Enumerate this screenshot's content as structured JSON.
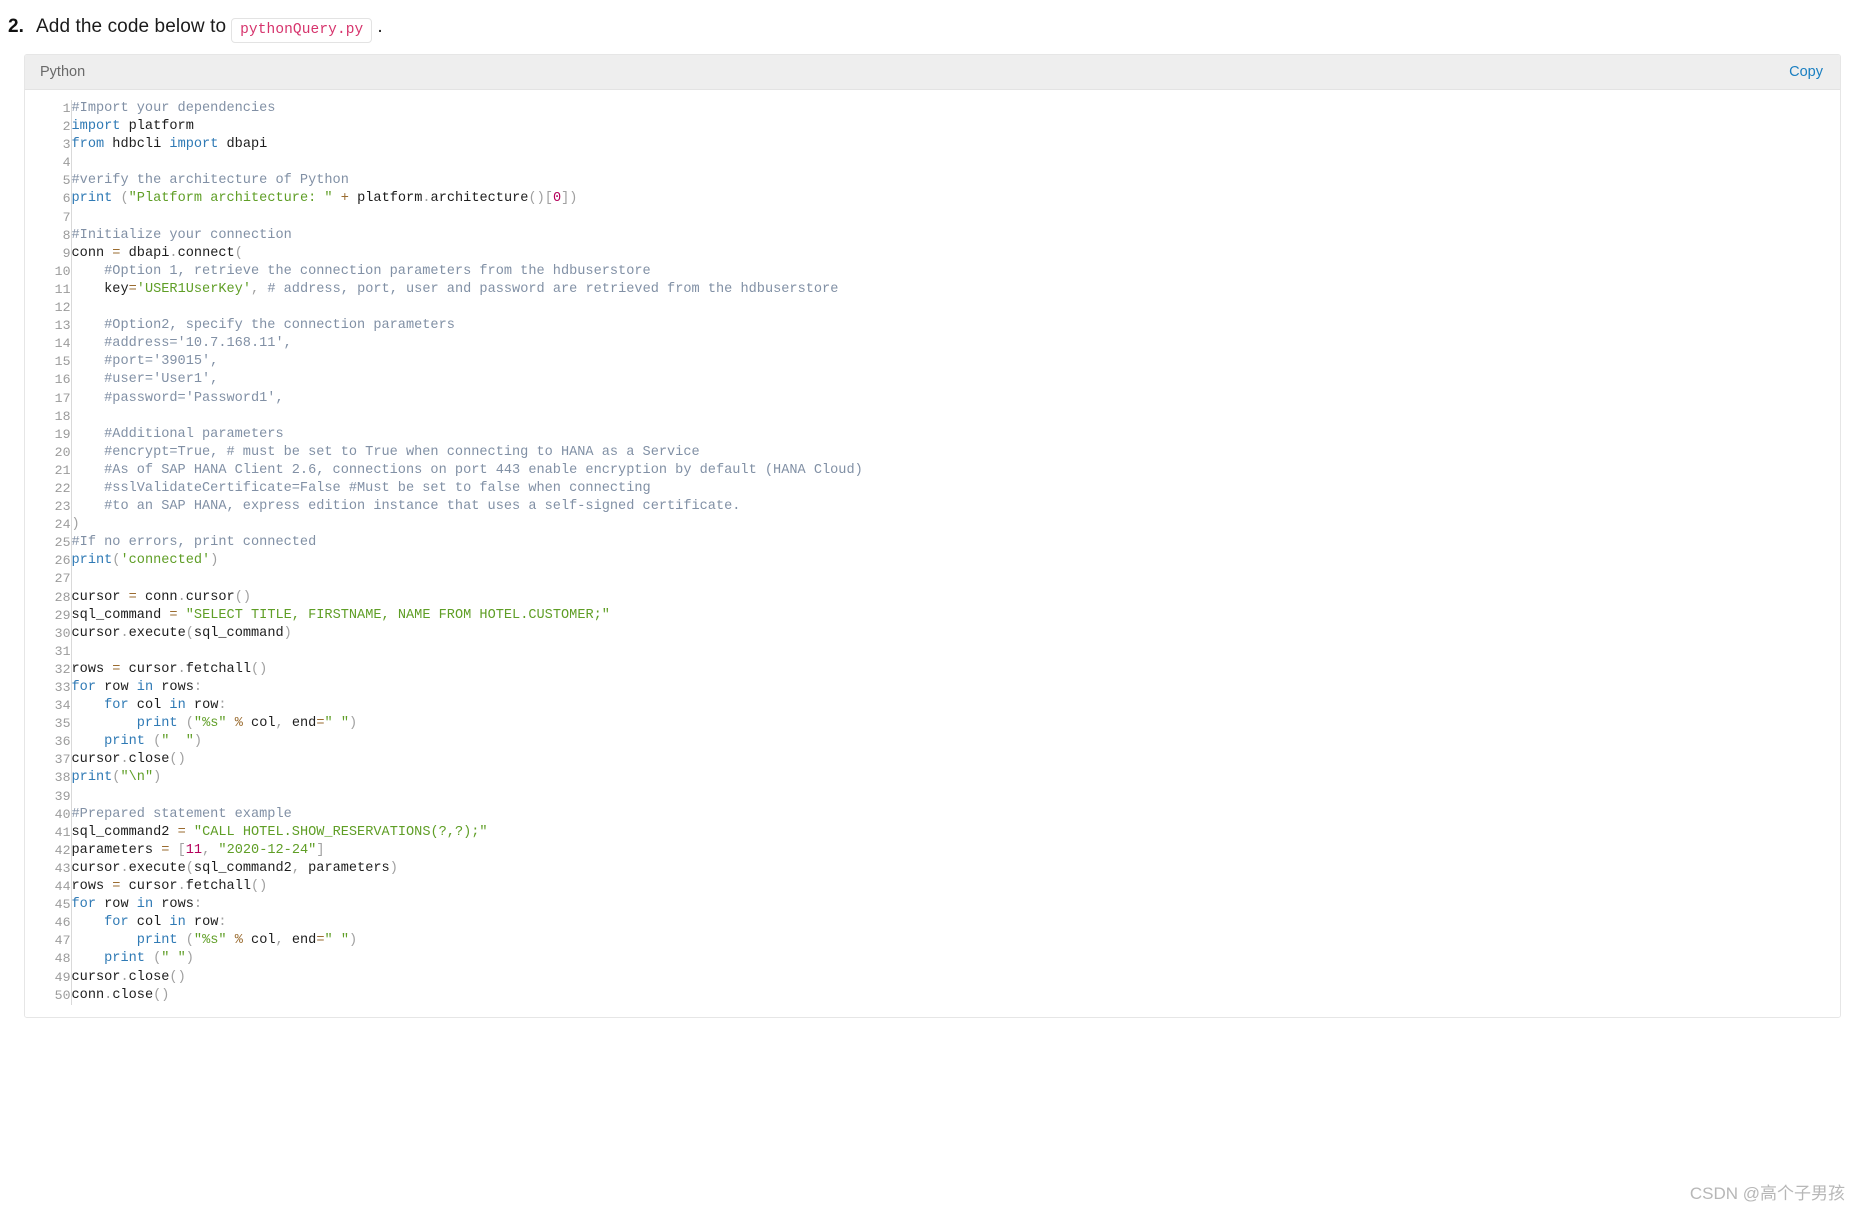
{
  "step": {
    "number": "2.",
    "text_before": "Add the code below to",
    "inline_code": "pythonQuery.py",
    "text_after": "."
  },
  "code_block": {
    "language": "Python",
    "copy_label": "Copy",
    "first_line": 1,
    "total_lines": 50,
    "colors": {
      "comment": "#8190a5",
      "keyword": "#2f7ab5",
      "string": "#5f9e26",
      "number": "#b4005a",
      "operator": "#9a6b2f",
      "punctuation": "#a0a0a0",
      "plain": "#1d1d1d",
      "header_bg": "#eeeeee",
      "link": "#1a7fc1"
    },
    "lines": [
      [
        [
          "c-com",
          "#Import your dependencies"
        ]
      ],
      [
        [
          "c-kw",
          "import"
        ],
        [
          "c-txt",
          " platform"
        ]
      ],
      [
        [
          "c-kw",
          "from"
        ],
        [
          "c-txt",
          " hdbcli "
        ],
        [
          "c-kw",
          "import"
        ],
        [
          "c-txt",
          " dbapi"
        ]
      ],
      [],
      [
        [
          "c-com",
          "#verify the architecture of Python"
        ]
      ],
      [
        [
          "c-kw",
          "print"
        ],
        [
          "c-txt",
          " "
        ],
        [
          "c-pun",
          "("
        ],
        [
          "c-str",
          "\"Platform architecture: \""
        ],
        [
          "c-txt",
          " "
        ],
        [
          "c-op",
          "+"
        ],
        [
          "c-txt",
          " platform"
        ],
        [
          "c-pun",
          "."
        ],
        [
          "c-txt",
          "architecture"
        ],
        [
          "c-pun",
          "()"
        ],
        [
          "c-pun",
          "["
        ],
        [
          "c-num",
          "0"
        ],
        [
          "c-pun",
          "])"
        ]
      ],
      [],
      [
        [
          "c-com",
          "#Initialize your connection"
        ]
      ],
      [
        [
          "c-txt",
          "conn "
        ],
        [
          "c-op",
          "="
        ],
        [
          "c-txt",
          " dbapi"
        ],
        [
          "c-pun",
          "."
        ],
        [
          "c-txt",
          "connect"
        ],
        [
          "c-pun",
          "("
        ]
      ],
      [
        [
          "c-com",
          "    #Option 1, retrieve the connection parameters from the hdbuserstore"
        ]
      ],
      [
        [
          "c-txt",
          "    key"
        ],
        [
          "c-op",
          "="
        ],
        [
          "c-str",
          "'USER1UserKey'"
        ],
        [
          "c-pun",
          ","
        ],
        [
          "c-com",
          " # address, port, user and password are retrieved from the hdbuserstore"
        ]
      ],
      [],
      [
        [
          "c-com",
          "    #Option2, specify the connection parameters"
        ]
      ],
      [
        [
          "c-com",
          "    #address='10.7.168.11',"
        ]
      ],
      [
        [
          "c-com",
          "    #port='39015',"
        ]
      ],
      [
        [
          "c-com",
          "    #user='User1',"
        ]
      ],
      [
        [
          "c-com",
          "    #password='Password1',"
        ]
      ],
      [],
      [
        [
          "c-com",
          "    #Additional parameters"
        ]
      ],
      [
        [
          "c-com",
          "    #encrypt=True, # must be set to True when connecting to HANA as a Service"
        ]
      ],
      [
        [
          "c-com",
          "    #As of SAP HANA Client 2.6, connections on port 443 enable encryption by default (HANA Cloud)"
        ]
      ],
      [
        [
          "c-com",
          "    #sslValidateCertificate=False #Must be set to false when connecting"
        ]
      ],
      [
        [
          "c-com",
          "    #to an SAP HANA, express edition instance that uses a self-signed certificate."
        ]
      ],
      [
        [
          "c-pun",
          ")"
        ]
      ],
      [
        [
          "c-com",
          "#If no errors, print connected"
        ]
      ],
      [
        [
          "c-kw",
          "print"
        ],
        [
          "c-pun",
          "("
        ],
        [
          "c-str",
          "'connected'"
        ],
        [
          "c-pun",
          ")"
        ]
      ],
      [],
      [
        [
          "c-txt",
          "cursor "
        ],
        [
          "c-op",
          "="
        ],
        [
          "c-txt",
          " conn"
        ],
        [
          "c-pun",
          "."
        ],
        [
          "c-txt",
          "cursor"
        ],
        [
          "c-pun",
          "()"
        ]
      ],
      [
        [
          "c-txt",
          "sql_command "
        ],
        [
          "c-op",
          "="
        ],
        [
          "c-txt",
          " "
        ],
        [
          "c-str",
          "\"SELECT TITLE, FIRSTNAME, NAME FROM HOTEL.CUSTOMER;\""
        ]
      ],
      [
        [
          "c-txt",
          "cursor"
        ],
        [
          "c-pun",
          "."
        ],
        [
          "c-txt",
          "execute"
        ],
        [
          "c-pun",
          "("
        ],
        [
          "c-txt",
          "sql_command"
        ],
        [
          "c-pun",
          ")"
        ]
      ],
      [],
      [
        [
          "c-txt",
          "rows "
        ],
        [
          "c-op",
          "="
        ],
        [
          "c-txt",
          " cursor"
        ],
        [
          "c-pun",
          "."
        ],
        [
          "c-txt",
          "fetchall"
        ],
        [
          "c-pun",
          "()"
        ]
      ],
      [
        [
          "c-kw",
          "for"
        ],
        [
          "c-txt",
          " row "
        ],
        [
          "c-kw",
          "in"
        ],
        [
          "c-txt",
          " rows"
        ],
        [
          "c-pun",
          ":"
        ]
      ],
      [
        [
          "c-txt",
          "    "
        ],
        [
          "c-kw",
          "for"
        ],
        [
          "c-txt",
          " col "
        ],
        [
          "c-kw",
          "in"
        ],
        [
          "c-txt",
          " row"
        ],
        [
          "c-pun",
          ":"
        ]
      ],
      [
        [
          "c-txt",
          "        "
        ],
        [
          "c-kw",
          "print"
        ],
        [
          "c-txt",
          " "
        ],
        [
          "c-pun",
          "("
        ],
        [
          "c-str",
          "\"%s\""
        ],
        [
          "c-txt",
          " "
        ],
        [
          "c-op",
          "%"
        ],
        [
          "c-txt",
          " col"
        ],
        [
          "c-pun",
          ","
        ],
        [
          "c-txt",
          " end"
        ],
        [
          "c-op",
          "="
        ],
        [
          "c-str",
          "\" \""
        ],
        [
          "c-pun",
          ")"
        ]
      ],
      [
        [
          "c-txt",
          "    "
        ],
        [
          "c-kw",
          "print"
        ],
        [
          "c-txt",
          " "
        ],
        [
          "c-pun",
          "("
        ],
        [
          "c-str",
          "\"  \""
        ],
        [
          "c-pun",
          ")"
        ]
      ],
      [
        [
          "c-txt",
          "cursor"
        ],
        [
          "c-pun",
          "."
        ],
        [
          "c-txt",
          "close"
        ],
        [
          "c-pun",
          "()"
        ]
      ],
      [
        [
          "c-kw",
          "print"
        ],
        [
          "c-pun",
          "("
        ],
        [
          "c-str",
          "\"\\n\""
        ],
        [
          "c-pun",
          ")"
        ]
      ],
      [],
      [
        [
          "c-com",
          "#Prepared statement example"
        ]
      ],
      [
        [
          "c-txt",
          "sql_command2 "
        ],
        [
          "c-op",
          "="
        ],
        [
          "c-txt",
          " "
        ],
        [
          "c-str",
          "\"CALL HOTEL.SHOW_RESERVATIONS(?,?);\""
        ]
      ],
      [
        [
          "c-txt",
          "parameters "
        ],
        [
          "c-op",
          "="
        ],
        [
          "c-txt",
          " "
        ],
        [
          "c-pun",
          "["
        ],
        [
          "c-num",
          "11"
        ],
        [
          "c-pun",
          ","
        ],
        [
          "c-txt",
          " "
        ],
        [
          "c-str",
          "\"2020-12-24\""
        ],
        [
          "c-pun",
          "]"
        ]
      ],
      [
        [
          "c-txt",
          "cursor"
        ],
        [
          "c-pun",
          "."
        ],
        [
          "c-txt",
          "execute"
        ],
        [
          "c-pun",
          "("
        ],
        [
          "c-txt",
          "sql_command2"
        ],
        [
          "c-pun",
          ","
        ],
        [
          "c-txt",
          " parameters"
        ],
        [
          "c-pun",
          ")"
        ]
      ],
      [
        [
          "c-txt",
          "rows "
        ],
        [
          "c-op",
          "="
        ],
        [
          "c-txt",
          " cursor"
        ],
        [
          "c-pun",
          "."
        ],
        [
          "c-txt",
          "fetchall"
        ],
        [
          "c-pun",
          "()"
        ]
      ],
      [
        [
          "c-kw",
          "for"
        ],
        [
          "c-txt",
          " row "
        ],
        [
          "c-kw",
          "in"
        ],
        [
          "c-txt",
          " rows"
        ],
        [
          "c-pun",
          ":"
        ]
      ],
      [
        [
          "c-txt",
          "    "
        ],
        [
          "c-kw",
          "for"
        ],
        [
          "c-txt",
          " col "
        ],
        [
          "c-kw",
          "in"
        ],
        [
          "c-txt",
          " row"
        ],
        [
          "c-pun",
          ":"
        ]
      ],
      [
        [
          "c-txt",
          "        "
        ],
        [
          "c-kw",
          "print"
        ],
        [
          "c-txt",
          " "
        ],
        [
          "c-pun",
          "("
        ],
        [
          "c-str",
          "\"%s\""
        ],
        [
          "c-txt",
          " "
        ],
        [
          "c-op",
          "%"
        ],
        [
          "c-txt",
          " col"
        ],
        [
          "c-pun",
          ","
        ],
        [
          "c-txt",
          " end"
        ],
        [
          "c-op",
          "="
        ],
        [
          "c-str",
          "\" \""
        ],
        [
          "c-pun",
          ")"
        ]
      ],
      [
        [
          "c-txt",
          "    "
        ],
        [
          "c-kw",
          "print"
        ],
        [
          "c-txt",
          " "
        ],
        [
          "c-pun",
          "("
        ],
        [
          "c-str",
          "\" \""
        ],
        [
          "c-pun",
          ")"
        ]
      ],
      [
        [
          "c-txt",
          "cursor"
        ],
        [
          "c-pun",
          "."
        ],
        [
          "c-txt",
          "close"
        ],
        [
          "c-pun",
          "()"
        ]
      ],
      [
        [
          "c-txt",
          "conn"
        ],
        [
          "c-pun",
          "."
        ],
        [
          "c-txt",
          "close"
        ],
        [
          "c-pun",
          "()"
        ]
      ]
    ]
  },
  "watermark": "CSDN @高个子男孩"
}
